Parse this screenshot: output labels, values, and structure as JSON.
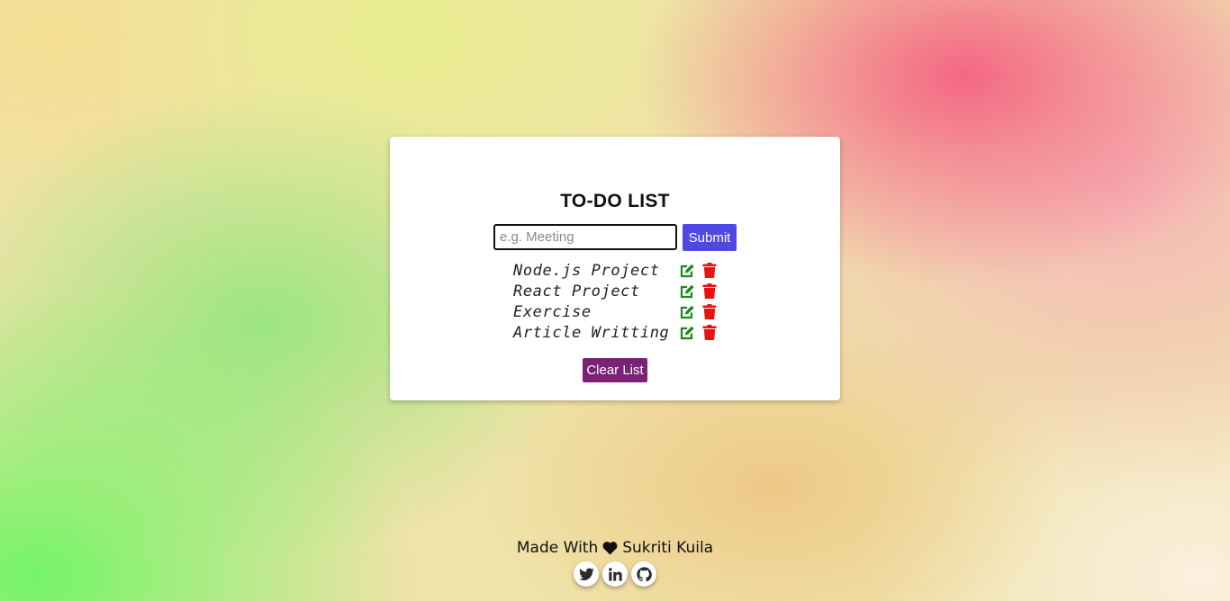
{
  "app": {
    "title": "TO-DO LIST"
  },
  "form": {
    "input_value": "",
    "input_placeholder": "e.g. Meeting",
    "submit_label": "Submit"
  },
  "tasks": [
    {
      "text": "Node.js Project",
      "edit_icon": "edit-icon",
      "delete_icon": "trash-icon"
    },
    {
      "text": "React Project",
      "edit_icon": "edit-icon",
      "delete_icon": "trash-icon"
    },
    {
      "text": "Exercise",
      "edit_icon": "edit-icon",
      "delete_icon": "trash-icon"
    },
    {
      "text": "Article Writting",
      "edit_icon": "edit-icon",
      "delete_icon": "trash-icon"
    }
  ],
  "clear_label": "Clear List",
  "footer": {
    "prefix": "Made With",
    "heart_icon": "heart-icon",
    "author": "Sukriti Kuila",
    "social": [
      {
        "icon": "twitter-icon"
      },
      {
        "icon": "linkedin-icon"
      },
      {
        "icon": "github-icon"
      }
    ]
  },
  "colors": {
    "submit": "#5048e5",
    "clear": "#7b2277",
    "edit": "#1a8a1a",
    "delete": "#e81212"
  }
}
